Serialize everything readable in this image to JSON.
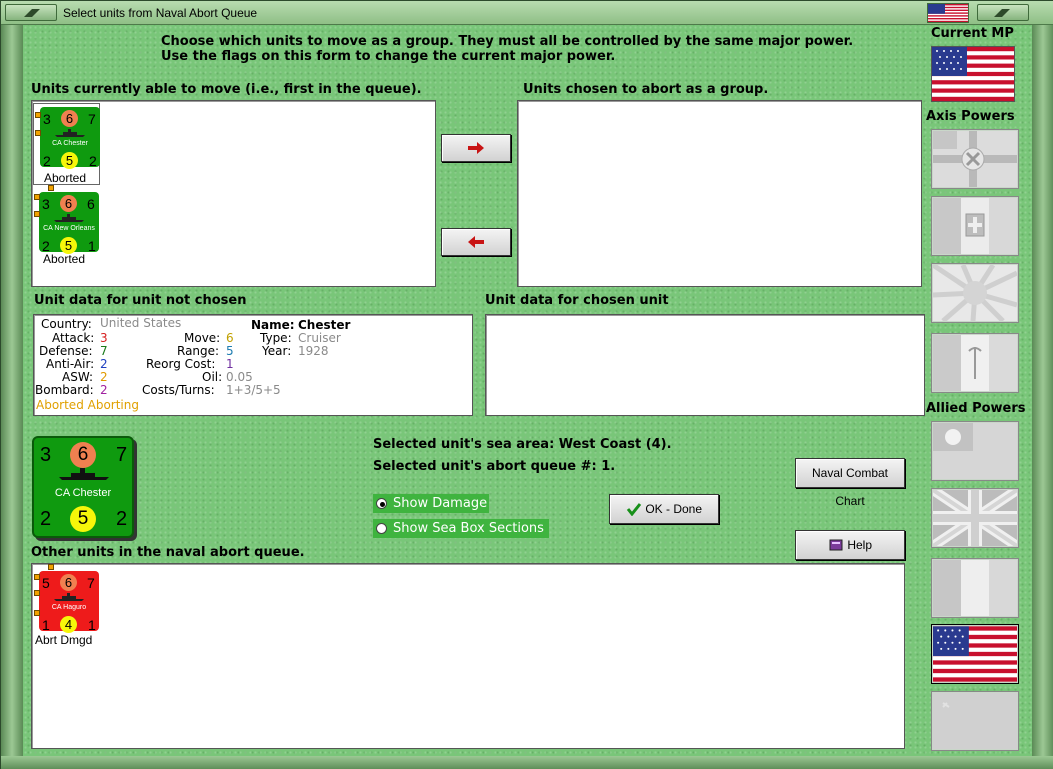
{
  "window": {
    "title": "Select units from Naval Abort Queue"
  },
  "instructions": {
    "line1": "Choose which units to move as a group.  They must all be controlled by the same major power.",
    "line2": "Use the flags on this form to change the current major power."
  },
  "left_list": {
    "label": "Units currently able to move (i.e., first in the queue).",
    "units": [
      {
        "name": "CA Chester",
        "top_left": "3",
        "top_mid": "6",
        "top_right": "7",
        "bot_left": "2",
        "bot_mid": "5",
        "bot_right": "2",
        "status": "Aborted"
      },
      {
        "name": "CA New Orleans",
        "top_left": "3",
        "top_mid": "6",
        "top_right": "6",
        "bot_left": "2",
        "bot_mid": "5",
        "bot_right": "1",
        "status": "Aborted"
      }
    ]
  },
  "right_list": {
    "label": "Units chosen to abort as a group."
  },
  "unit_data_left": {
    "label": "Unit data for unit not chosen",
    "country_k": "Country:",
    "country_v": "United States",
    "attack_k": "Attack:",
    "attack_v": "3",
    "defense_k": "Defense:",
    "defense_v": "7",
    "antiair_k": "Anti-Air:",
    "antiair_v": "2",
    "asw_k": "ASW:",
    "asw_v": "2",
    "bombard_k": "Bombard:",
    "bombard_v": "2",
    "move_k": "Move:",
    "move_v": "6",
    "range_k": "Range:",
    "range_v": "5",
    "reorg_k": "Reorg Cost:",
    "reorg_v": "1",
    "oil_k": "Oil:",
    "oil_v": "0.05",
    "costs_k": "Costs/Turns:",
    "costs_v": "1+3/5+5",
    "name_k": "Name:",
    "name_v": "Chester",
    "type_k": "Type:",
    "type_v": "Cruiser",
    "year_k": "Year:",
    "year_v": "1928",
    "status": "Aborted Aborting"
  },
  "unit_data_right": {
    "label": "Unit data for chosen unit"
  },
  "big_counter": {
    "name": "CA Chester",
    "top_left": "3",
    "top_mid": "6",
    "top_right": "7",
    "bot_left": "2",
    "bot_mid": "5",
    "bot_right": "2"
  },
  "info": {
    "sea_area": "Selected unit's sea area: West Coast (4).",
    "queue": "Selected unit's abort queue #: 1."
  },
  "options": {
    "show_damage": "Show Damage",
    "show_sea_box": "Show Sea Box Sections"
  },
  "buttons": {
    "naval_chart": "Naval Combat Chart",
    "ok": "OK - Done",
    "help": "Help"
  },
  "queue": {
    "label": "Other units in the naval abort queue.",
    "units": [
      {
        "name": "CA Haguro",
        "top_left": "5",
        "top_mid": "6",
        "top_right": "7",
        "bot_left": "1",
        "bot_mid": "4",
        "bot_right": "1",
        "status": "Abrt Dmgd"
      }
    ]
  },
  "side": {
    "current_mp": "Current MP",
    "axis": "Axis Powers",
    "allied": "Allied Powers"
  },
  "colors": {
    "attack": "#d62020",
    "defense": "#1a7a1a",
    "antiair": "#2040c0",
    "asw": "#e09a00",
    "bombard": "#a020a0",
    "move": "#c0a000",
    "range": "#1b7bb0",
    "reorg": "#7030a0",
    "grey": "#8a8a8a",
    "status": "#e0a000"
  },
  "icons": [
    "menu-icon",
    "us-flag-icon",
    "minimize-icon",
    "ship-icon",
    "arrow-right-icon",
    "arrow-left-icon",
    "checkmark-icon",
    "book-icon"
  ]
}
